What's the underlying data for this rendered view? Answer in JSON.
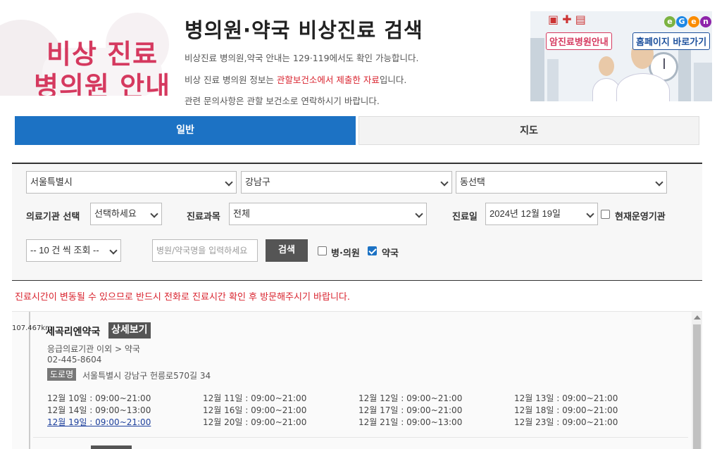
{
  "header": {
    "logo_line1": "비상 진료",
    "logo_line2": "병의원 안내",
    "title": "병의원·약국 비상진료 검색",
    "info1": "비상진료 병의원,약국 안내는 129·119에서도 확인 가능합니다.",
    "info2_pre": "비상 진료 병의원 정보는 ",
    "info2_red": "관할보건소에서 제출한 자료",
    "info2_post": "입니다.",
    "info3": "관련 문의사항은 관할 보건소로 연락하시기 바랍니다."
  },
  "banner": {
    "btn_cancer": "암진료병원안내",
    "btn_home": "홈페이지 바로가기",
    "eum_letters": [
      "e",
      "G",
      "e",
      "n"
    ]
  },
  "tabs": [
    {
      "label": "일반",
      "active": true
    },
    {
      "label": "지도",
      "active": false
    }
  ],
  "search": {
    "city": "서울특별시",
    "district": "강남구",
    "dong": "동선택",
    "facility_label": "의료기관 선택",
    "facility_value": "선택하세요",
    "subject_label": "진료과목",
    "subject_value": "전체",
    "date_label": "진료일",
    "date_value": "2024년 12월 19일",
    "operating_label": "현재운영기관",
    "page_size": "-- 10 건 씩 조회 --",
    "keyword_placeholder": "병원/약국명을 입력하세요",
    "search_button": "검색",
    "hospital_label": "병·의원",
    "pharmacy_label": "약국",
    "hospital_checked": false,
    "pharmacy_checked": true
  },
  "notice": "진료시간이 변동될 수 있으므로 반드시 전화로 진료시간 확인 후 방문해주시기 바랍니다.",
  "results": [
    {
      "distance": "107.467km",
      "name": "세곡리엔약국",
      "detail_label": "상세보기",
      "category": "응급의료기관 이외 > 약국",
      "tel": "02-445-8604",
      "road_badge": "도로명",
      "address": "서울특별시 강남구 헌릉로570길 34",
      "schedule": [
        "12월 10일 : 09:00~21:00",
        "12월 11일 : 09:00~21:00",
        "12월 12일 : 09:00~21:00",
        "12월 13일 : 09:00~21:00",
        "12월 14일 : 09:00~13:00",
        "12월 16일 : 09:00~21:00",
        "12월 17일 : 09:00~21:00",
        "12월 18일 : 09:00~21:00",
        "12월 19일 : 09:00~21:00",
        "12월 20일 : 09:00~21:00",
        "12월 21일 : 09:00~13:00",
        "12월 23일 : 09:00~21:00"
      ],
      "today_index": 8
    }
  ],
  "colors": {
    "accent_blue": "#1c72c4",
    "logo_pink": "#d5395f",
    "notice_red": "#d9232e"
  }
}
